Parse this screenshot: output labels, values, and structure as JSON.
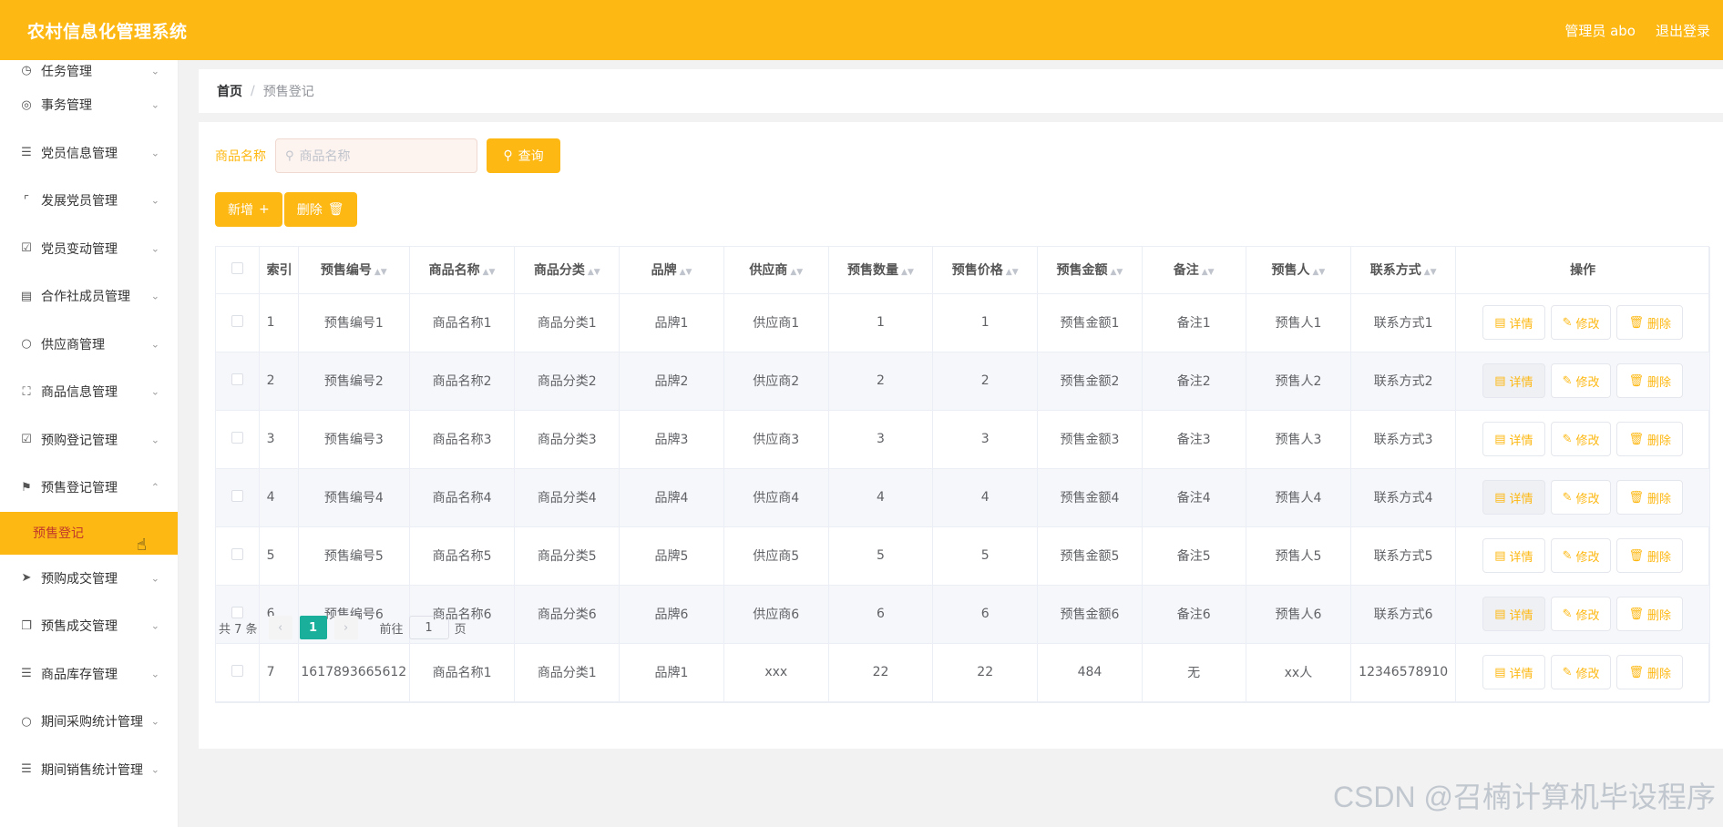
{
  "header": {
    "title": "农村信息化管理系统",
    "admin": "管理员 abo",
    "logout": "退出登录",
    "bg": "#fdb813"
  },
  "sidebar": {
    "items": [
      {
        "label": "任务管理",
        "icon": "clock-icon"
      },
      {
        "label": "事务管理",
        "icon": "lifebuoy-icon"
      },
      {
        "label": "党员信息管理",
        "icon": "sliders-icon"
      },
      {
        "label": "发展党员管理",
        "icon": "crop-icon"
      },
      {
        "label": "党员变动管理",
        "icon": "clipboard-check-icon"
      },
      {
        "label": "合作社成员管理",
        "icon": "clipboard-icon"
      },
      {
        "label": "供应商管理",
        "icon": "mic-icon"
      },
      {
        "label": "商品信息管理",
        "icon": "fullscreen-icon"
      },
      {
        "label": "预购登记管理",
        "icon": "clipboard-check-icon"
      },
      {
        "label": "预售登记管理",
        "icon": "flag-icon"
      }
    ],
    "sub_active": "预售登记",
    "items_after": [
      {
        "label": "预购成交管理",
        "icon": "send-icon"
      },
      {
        "label": "预售成交管理",
        "icon": "copy-icon"
      },
      {
        "label": "商品库存管理",
        "icon": "list-icon"
      },
      {
        "label": "期间采购统计管理",
        "icon": "microphone-icon"
      },
      {
        "label": "期间销售统计管理",
        "icon": "list-icon"
      }
    ]
  },
  "breadcrumb": {
    "home": "首页",
    "sep": "/",
    "current": "预售登记"
  },
  "search": {
    "label": "商品名称",
    "placeholder": "商品名称",
    "button": "查询"
  },
  "actions": {
    "add": "新增",
    "delete": "删除"
  },
  "table": {
    "columns": [
      "索引",
      "预售编号",
      "商品名称",
      "商品分类",
      "品牌",
      "供应商",
      "预售数量",
      "预售价格",
      "预售金额",
      "备注",
      "预售人",
      "联系方式",
      "操作"
    ],
    "rows": [
      [
        "1",
        "预售编号1",
        "商品名称1",
        "商品分类1",
        "品牌1",
        "供应商1",
        "1",
        "1",
        "预售金额1",
        "备注1",
        "预售人1",
        "联系方式1"
      ],
      [
        "2",
        "预售编号2",
        "商品名称2",
        "商品分类2",
        "品牌2",
        "供应商2",
        "2",
        "2",
        "预售金额2",
        "备注2",
        "预售人2",
        "联系方式2"
      ],
      [
        "3",
        "预售编号3",
        "商品名称3",
        "商品分类3",
        "品牌3",
        "供应商3",
        "3",
        "3",
        "预售金额3",
        "备注3",
        "预售人3",
        "联系方式3"
      ],
      [
        "4",
        "预售编号4",
        "商品名称4",
        "商品分类4",
        "品牌4",
        "供应商4",
        "4",
        "4",
        "预售金额4",
        "备注4",
        "预售人4",
        "联系方式4"
      ],
      [
        "5",
        "预售编号5",
        "商品名称5",
        "商品分类5",
        "品牌5",
        "供应商5",
        "5",
        "5",
        "预售金额5",
        "备注5",
        "预售人5",
        "联系方式5"
      ],
      [
        "6",
        "预售编号6",
        "商品名称6",
        "商品分类6",
        "品牌6",
        "供应商6",
        "6",
        "6",
        "预售金额6",
        "备注6",
        "预售人6",
        "联系方式6"
      ],
      [
        "7",
        "1617893665612",
        "商品名称1",
        "商品分类1",
        "品牌1",
        "xxx",
        "22",
        "22",
        "484",
        "无",
        "xx人",
        "12346578910"
      ]
    ],
    "ops": {
      "detail": "详情",
      "edit": "修改",
      "delete": "删除"
    }
  },
  "pager": {
    "total": "共 7 条",
    "page": "1",
    "goto_prefix": "前往",
    "goto_value": "1",
    "goto_suffix": "页"
  },
  "watermark": "CSDN @召楠计算机毕设程序"
}
